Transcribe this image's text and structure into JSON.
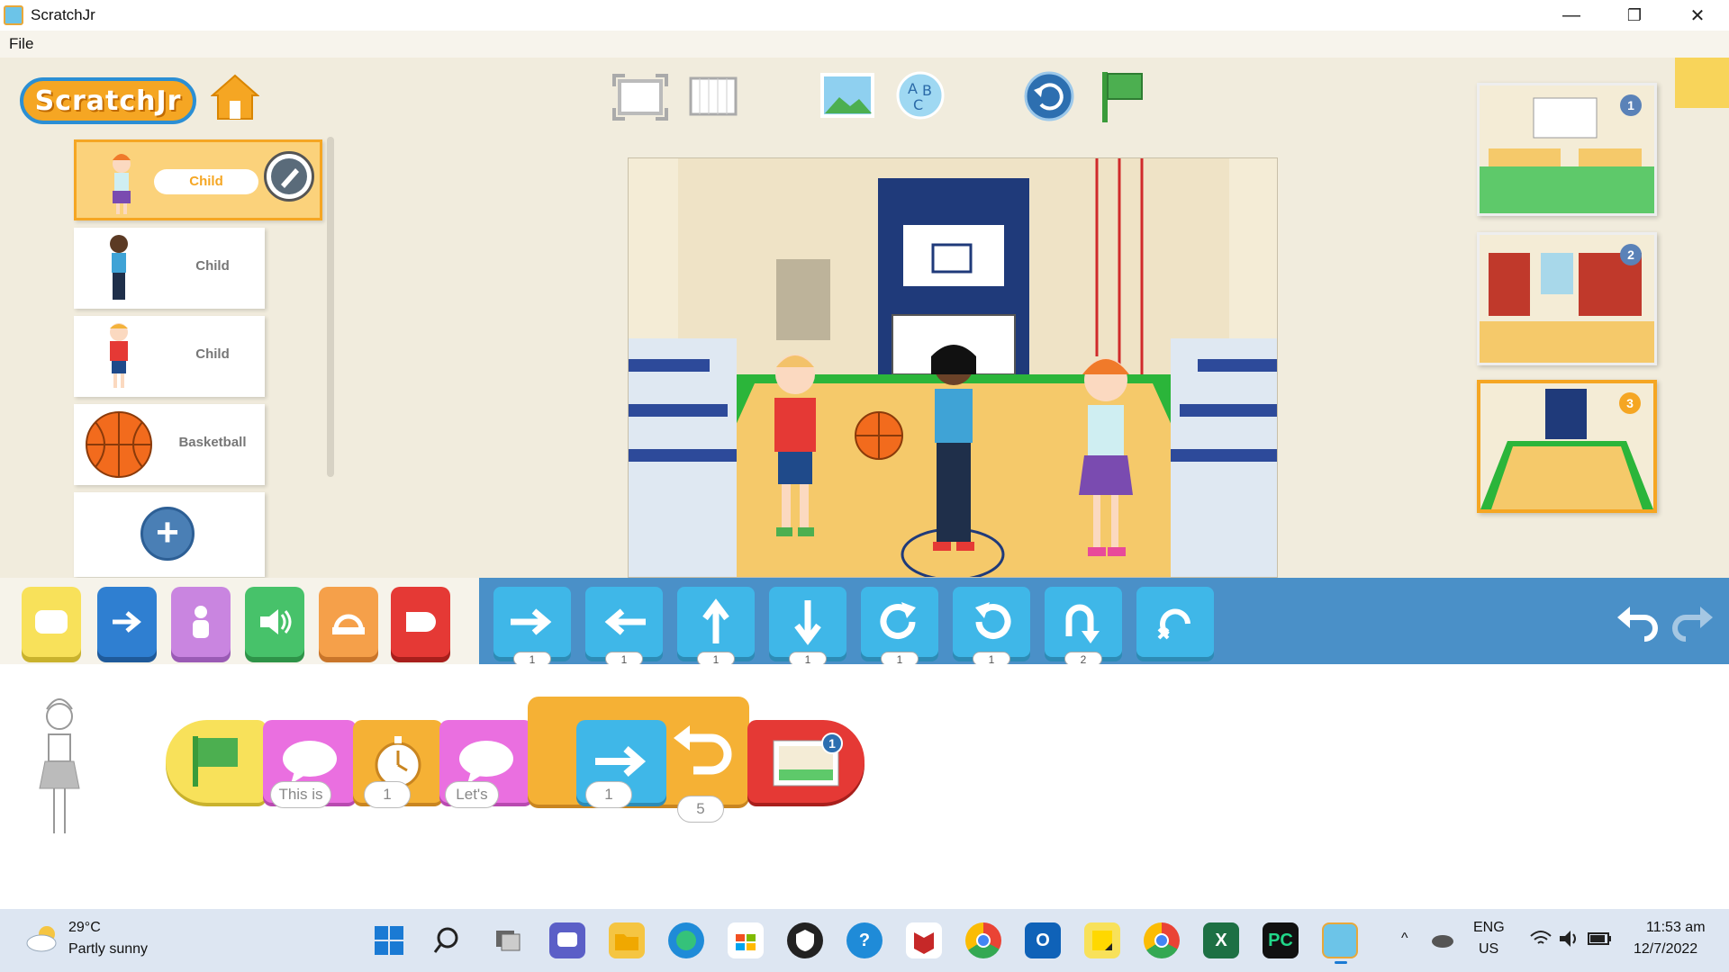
{
  "window": {
    "title": "ScratchJr",
    "minimize": "—",
    "restore": "❐",
    "close": "✕"
  },
  "menu": {
    "file": "File"
  },
  "logo": {
    "text": "ScratchJr"
  },
  "sprites": [
    {
      "name": "Child",
      "active": true
    },
    {
      "name": "Child",
      "active": false
    },
    {
      "name": "Child",
      "active": false
    },
    {
      "name": "Basketball",
      "active": false
    }
  ],
  "add_sprite": "+",
  "pages": [
    {
      "num": "1"
    },
    {
      "num": "2"
    },
    {
      "num": "3"
    }
  ],
  "palette": {
    "blocks": [
      {
        "icon": "move-right",
        "num": "1"
      },
      {
        "icon": "move-left",
        "num": "1"
      },
      {
        "icon": "move-up",
        "num": "1"
      },
      {
        "icon": "move-down",
        "num": "1"
      },
      {
        "icon": "turn-right",
        "num": "1"
      },
      {
        "icon": "turn-left",
        "num": "1"
      },
      {
        "icon": "hop",
        "num": "2"
      },
      {
        "icon": "go-home",
        "num": ""
      }
    ]
  },
  "script": {
    "say1": "This is",
    "wait": "1",
    "say2": "Let's",
    "move": "1",
    "repeat": "5",
    "page": "1"
  },
  "taskbar": {
    "temp": "29°C",
    "weather": "Partly sunny",
    "lang1": "ENG",
    "lang2": "US",
    "time": "11:53 am",
    "date": "12/7/2022"
  }
}
